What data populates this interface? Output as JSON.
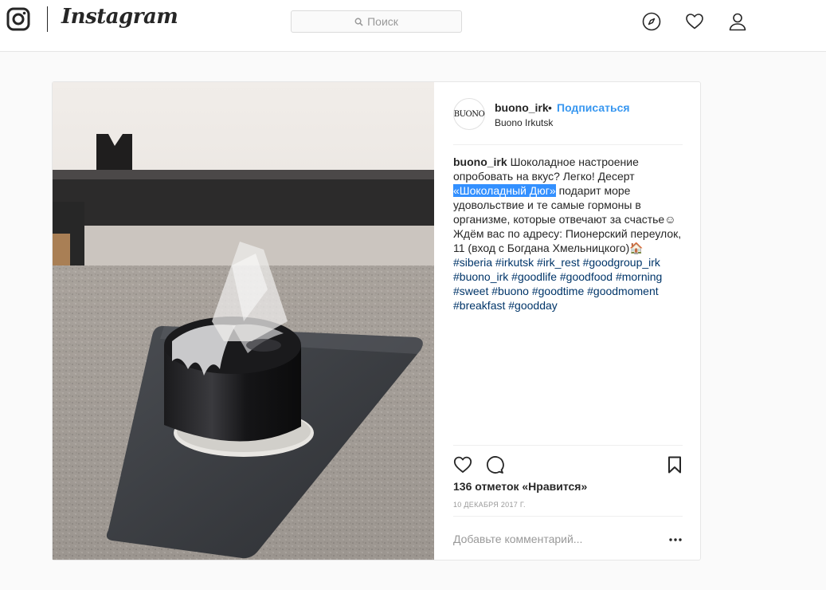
{
  "nav": {
    "brand": "Instagram",
    "search_placeholder": "Поиск",
    "icons": [
      "instagram-logo-icon",
      "search-icon",
      "explore-compass-icon",
      "activity-heart-icon",
      "profile-icon"
    ]
  },
  "post": {
    "avatar_text": "BUONO",
    "username": "buono_irk",
    "separator": "•",
    "follow_label": "Подписаться",
    "location": "Buono Irkutsk",
    "caption": {
      "user": "buono_irk",
      "text_before": "Шоколадное настроение опробовать на вкус? Легко! Десерт",
      "highlight": "«Шоколадный Дюг»",
      "text_after": "подарит море удовольствие и те самые гормоны в организме, которые отвечают за счастье☺ Ждём вас по адресу: Пионерский переулок, 11 (вход с Богдана Хмельницкого)🏠",
      "hashtags": "#siberia #irkutsk #irk_rest #goodgroup_irk #buono_irk #goodlife #goodfood #morning #sweet #buono #goodtime #goodmoment #breakfast #goodday"
    },
    "likes": "136 отметок «Нравится»",
    "date": "10 декабря 2017 г.",
    "comment_placeholder": "Добавьте комментарий...",
    "image_alt": "Black chocolate dessert on slate plate"
  },
  "colors": {
    "link_blue": "#3897f0",
    "hashtag": "#003569",
    "selection": "#3390ff",
    "muted": "#999999"
  }
}
